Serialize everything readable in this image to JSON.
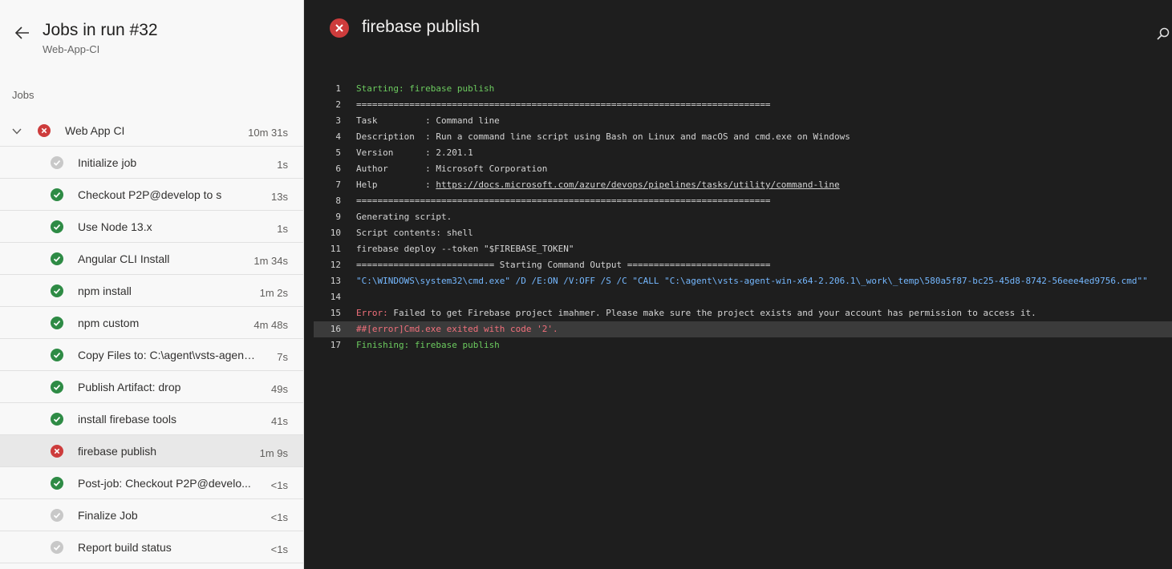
{
  "header": {
    "title": "Jobs in run #32",
    "subtitle": "Web-App-CI",
    "section_label": "Jobs"
  },
  "parent_job": {
    "name": "Web App CI",
    "duration": "10m 31s",
    "status": "failed"
  },
  "steps": [
    {
      "name": "Initialize job",
      "duration": "1s",
      "status": "skipped"
    },
    {
      "name": "Checkout P2P@develop to s",
      "duration": "13s",
      "status": "succeeded"
    },
    {
      "name": "Use Node 13.x",
      "duration": "1s",
      "status": "succeeded"
    },
    {
      "name": "Angular CLI Install",
      "duration": "1m 34s",
      "status": "succeeded"
    },
    {
      "name": "npm install",
      "duration": "1m 2s",
      "status": "succeeded"
    },
    {
      "name": "npm custom",
      "duration": "4m 48s",
      "status": "succeeded"
    },
    {
      "name": "Copy Files to: C:\\agent\\vsts-agent...",
      "duration": "7s",
      "status": "succeeded"
    },
    {
      "name": "Publish Artifact: drop",
      "duration": "49s",
      "status": "succeeded"
    },
    {
      "name": "install firebase tools",
      "duration": "41s",
      "status": "succeeded"
    },
    {
      "name": "firebase publish",
      "duration": "1m 9s",
      "status": "failed",
      "selected": true
    },
    {
      "name": "Post-job: Checkout P2P@develo...",
      "duration": "<1s",
      "status": "succeeded"
    },
    {
      "name": "Finalize Job",
      "duration": "<1s",
      "status": "skipped"
    },
    {
      "name": "Report build status",
      "duration": "<1s",
      "status": "skipped"
    }
  ],
  "log_panel": {
    "title": "firebase publish",
    "lines": [
      {
        "n": "1",
        "text": "Starting: firebase publish",
        "style": "green"
      },
      {
        "n": "2",
        "text": "==============================================================================",
        "style": ""
      },
      {
        "n": "3",
        "text": "Task         : Command line",
        "style": ""
      },
      {
        "n": "4",
        "text": "Description  : Run a command line script using Bash on Linux and macOS and cmd.exe on Windows",
        "style": ""
      },
      {
        "n": "5",
        "text": "Version      : 2.201.1",
        "style": ""
      },
      {
        "n": "6",
        "text": "Author       : Microsoft Corporation",
        "style": ""
      },
      {
        "n": "7",
        "text": "Help         : ",
        "link": "https://docs.microsoft.com/azure/devops/pipelines/tasks/utility/command-line",
        "style": ""
      },
      {
        "n": "8",
        "text": "==============================================================================",
        "style": ""
      },
      {
        "n": "9",
        "text": "Generating script.",
        "style": ""
      },
      {
        "n": "10",
        "text": "Script contents: shell",
        "style": ""
      },
      {
        "n": "11",
        "text": "firebase deploy --token \"$FIREBASE_TOKEN\"",
        "style": ""
      },
      {
        "n": "12",
        "text": "========================== Starting Command Output ===========================",
        "style": ""
      },
      {
        "n": "13",
        "text": "\"C:\\WINDOWS\\system32\\cmd.exe\" /D /E:ON /V:OFF /S /C \"CALL \"C:\\agent\\vsts-agent-win-x64-2.206.1\\_work\\_temp\\580a5f87-bc25-45d8-8742-56eee4ed9756.cmd\"\"",
        "style": "blue"
      },
      {
        "n": "14",
        "text": "",
        "style": ""
      },
      {
        "n": "15",
        "prefix": "Error:",
        "text": " Failed to get Firebase project imahmer. Please make sure the project exists and your account has permission to access it.",
        "style": ""
      },
      {
        "n": "16",
        "text": "##[error]Cmd.exe exited with code '2'.",
        "style": "red",
        "highlight": true
      },
      {
        "n": "17",
        "text": "Finishing: firebase publish",
        "style": "green"
      }
    ]
  },
  "colors": {
    "success": "#2e8b45",
    "failed": "#cd3c3c",
    "skipped": "#c8c8c8"
  }
}
